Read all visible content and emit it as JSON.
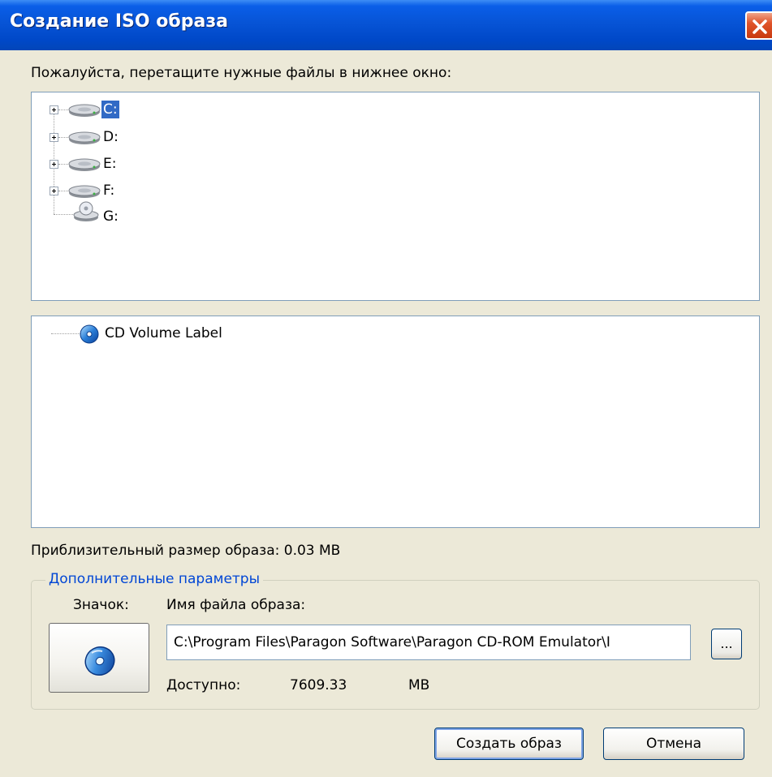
{
  "window": {
    "title": "Создание ISO образа",
    "close_icon": "close-icon"
  },
  "instruction": "Пожалуйста, перетащите нужные файлы в нижнее окно:",
  "drives": [
    {
      "label": "C:",
      "icon": "hard-drive-icon",
      "selected": true,
      "expandable": true
    },
    {
      "label": "D:",
      "icon": "hard-drive-icon",
      "selected": false,
      "expandable": true
    },
    {
      "label": "E:",
      "icon": "hard-drive-icon",
      "selected": false,
      "expandable": true
    },
    {
      "label": "F:",
      "icon": "hard-drive-icon",
      "selected": false,
      "expandable": true
    },
    {
      "label": "G:",
      "icon": "cd-drive-icon",
      "selected": false,
      "expandable": false
    }
  ],
  "iso_tree": {
    "root_label": "CD Volume Label",
    "icon": "cd-disc-icon"
  },
  "size_info": "Приблизительный размер образа: 0.03 MB",
  "options": {
    "legend": "Дополнительные параметры",
    "icon_label": "Значок:",
    "filename_label": "Имя файла образа:",
    "filename_value": "C:\\Program Files\\Paragon Software\\Paragon CD-ROM Emulator\\I",
    "browse_label": "...",
    "available_label": "Доступно:",
    "available_value": "7609.33",
    "available_unit": "MB"
  },
  "buttons": {
    "create": "Создать образ",
    "cancel": "Отмена"
  },
  "colors": {
    "titlebar": "#0754d6",
    "selection": "#316ac5",
    "group_legend": "#0046d5",
    "dialog_bg": "#ece9d8"
  }
}
